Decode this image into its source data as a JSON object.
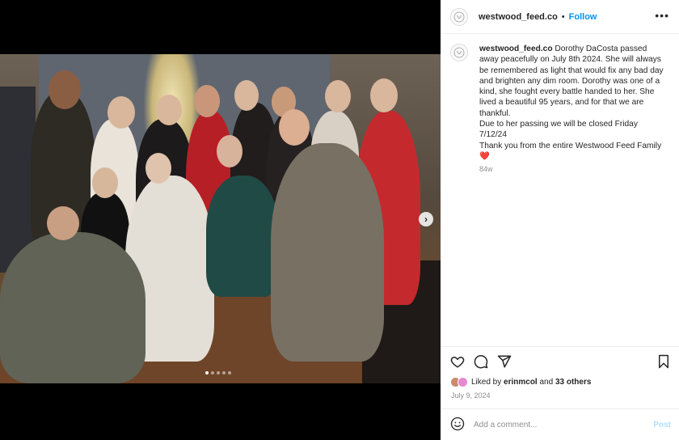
{
  "post": {
    "username": "westwood_feed.co",
    "follow_label": "Follow",
    "header_separator": "•",
    "more_label": "•••",
    "caption_lines": [
      "Dorothy DaCosta passed away peacefully on July 8th 2024. She will always be remembered as light that would fix any bad day and brighten any dim room. Dorothy was one of a kind, she fought every battle handed to her. She lived a beautiful 95 years, and for that we are thankful.",
      "Due to her passing we will be closed Friday 7/12/24",
      "Thank you from the entire Westwood Feed Family"
    ],
    "caption_emoji": "❤️",
    "caption_age": "84w",
    "likes_prefix": "Liked by",
    "liked_by_user": "erinmcol",
    "likes_joiner": "and",
    "likes_others": "33 others",
    "date": "July 9, 2024",
    "comment_placeholder": "Add a comment...",
    "post_button_label": "Post"
  },
  "carousel": {
    "slide_count": 5,
    "active_slide": 1,
    "next_label": "›"
  },
  "icons": {
    "like": "heart-icon",
    "comment": "comment-icon",
    "share": "paper-plane-icon",
    "save": "bookmark-icon",
    "emoji": "smiley-icon",
    "next": "chevron-right-icon",
    "more": "more-dots-icon"
  },
  "colors": {
    "link_blue": "#0095f6",
    "post_disabled": "#b2dffc",
    "muted": "#8e8e8e",
    "heart_red": "#e0424e"
  }
}
